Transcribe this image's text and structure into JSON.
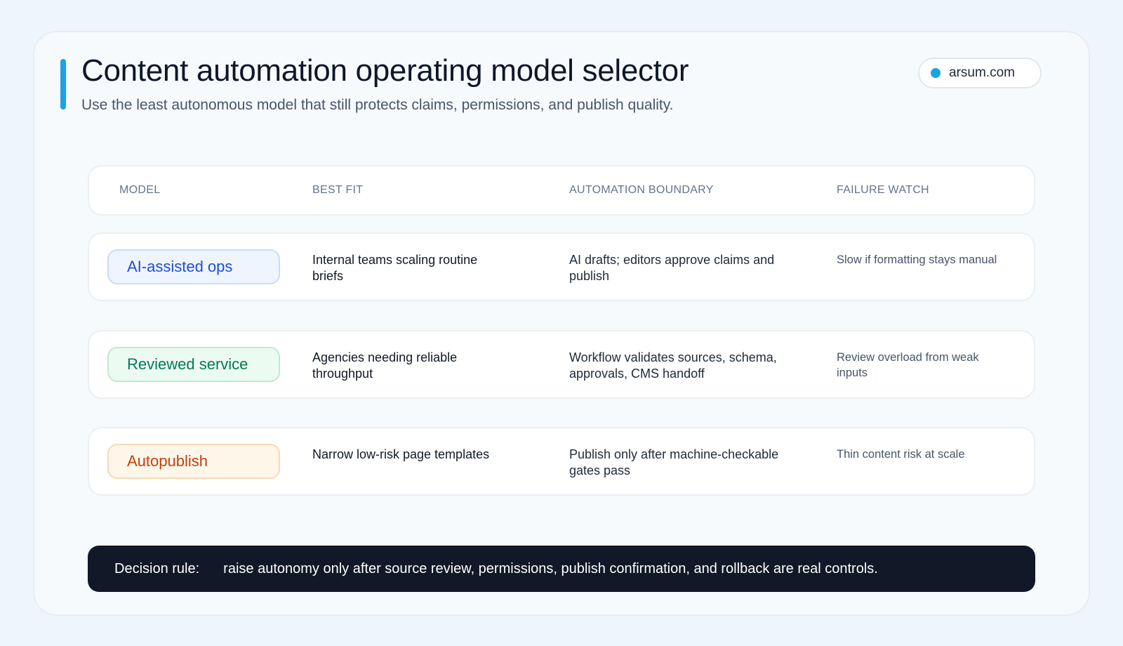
{
  "header": {
    "title": "Content automation operating model selector",
    "subtitle": "Use the least autonomous model that still protects claims, permissions, and publish quality.",
    "brand": "arsum.com"
  },
  "table": {
    "columns": [
      "MODEL",
      "BEST FIT",
      "AUTOMATION BOUNDARY",
      "FAILURE WATCH"
    ],
    "rows": [
      {
        "model": "AI-assisted ops",
        "tone": "blue",
        "best_fit": "Internal teams scaling routine briefs",
        "boundary": "AI drafts; editors approve claims and publish",
        "failure_watch": "Slow if formatting stays manual"
      },
      {
        "model": "Reviewed service",
        "tone": "green",
        "best_fit": "Agencies needing reliable throughput",
        "boundary": "Workflow validates sources, schema, approvals, CMS handoff",
        "failure_watch": "Review overload from weak inputs"
      },
      {
        "model": "Autopublish",
        "tone": "orange",
        "best_fit": "Narrow low-risk page templates",
        "boundary": "Publish only after machine-checkable gates pass",
        "failure_watch": "Thin content risk at scale"
      }
    ]
  },
  "decision": {
    "label": "Decision rule:",
    "text": "raise autonomy only after source review, permissions, publish confirmation, and rollback are real controls."
  },
  "colors": {
    "accent": "#1aa3e6",
    "blue": "#1d4ed8",
    "green": "#047857",
    "orange": "#c2410c",
    "dark": "#111827"
  }
}
